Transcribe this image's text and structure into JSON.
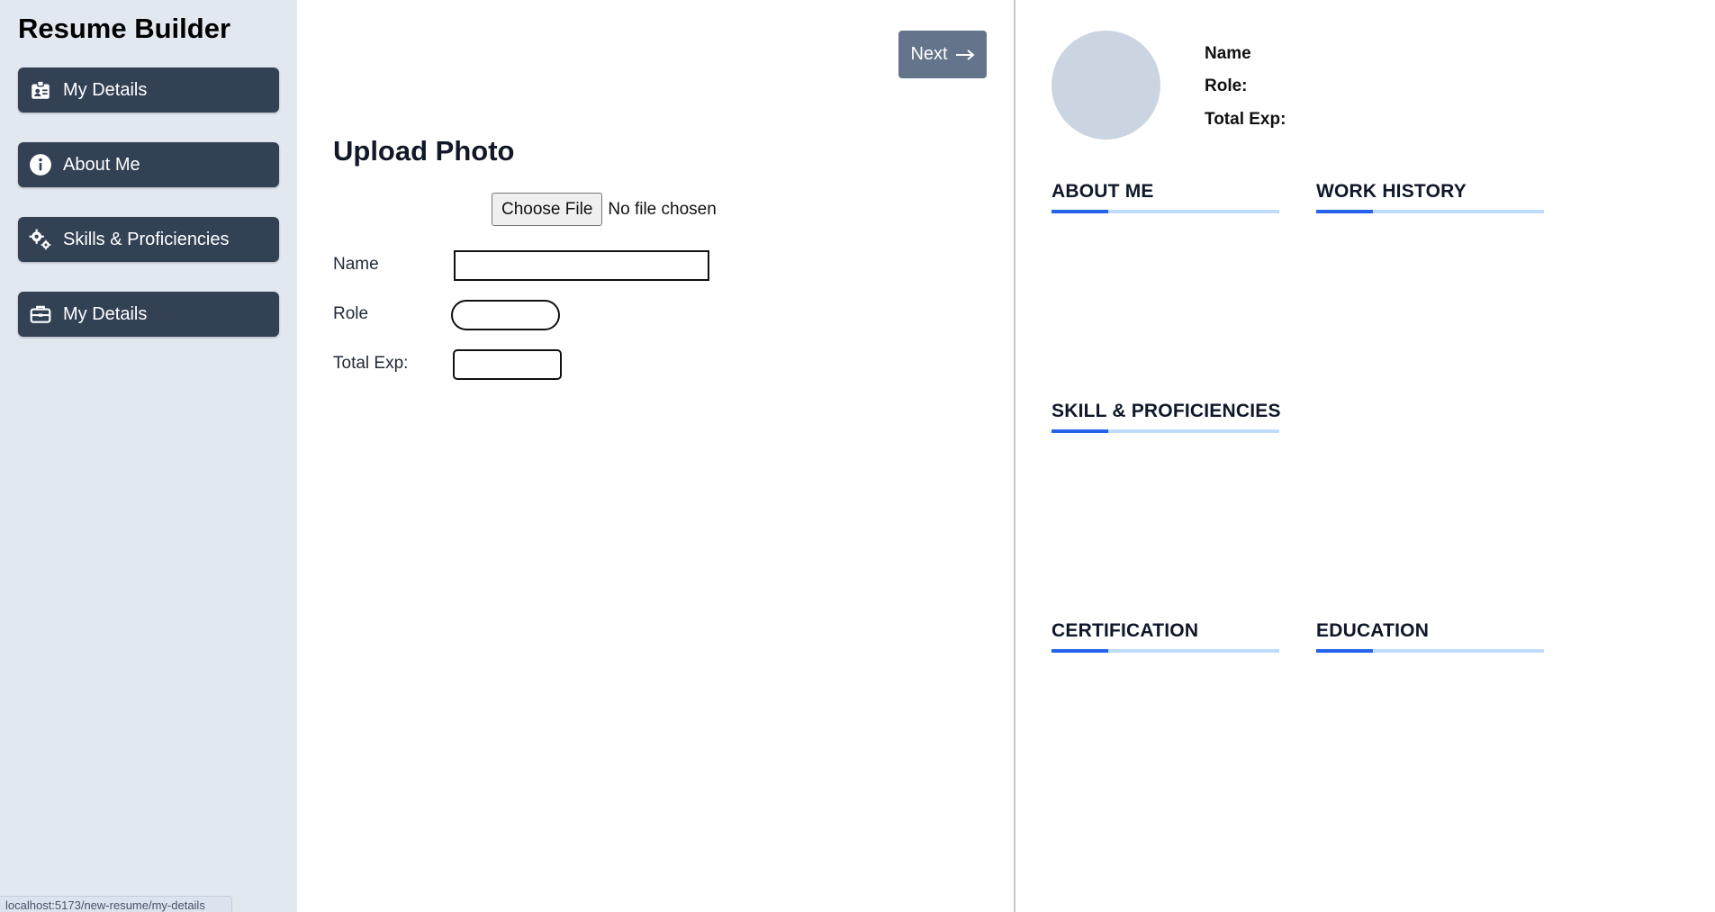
{
  "sidebar": {
    "title": "Resume Builder",
    "items": [
      {
        "label": "My Details",
        "icon": "id-badge-icon"
      },
      {
        "label": "About Me",
        "icon": "info-circle-icon"
      },
      {
        "label": "Skills & Proficiencies",
        "icon": "gears-icon"
      },
      {
        "label": "My Details",
        "icon": "briefcase-icon"
      }
    ]
  },
  "status_bar": {
    "url": "localhost:5173/new-resume/my-details"
  },
  "editor": {
    "next_label": "Next",
    "next_icon": "arrow-right-icon",
    "section_title": "Upload Photo",
    "file_button": "Choose File",
    "file_status": "No file chosen",
    "fields": {
      "name_label": "Name",
      "name_value": "",
      "role_label": "Role",
      "role_value": "",
      "exp_label": "Total Exp:",
      "exp_value": ""
    }
  },
  "preview": {
    "name_label": "Name",
    "role_label": "Role:",
    "exp_label": "Total Exp:",
    "sections": {
      "about": "ABOUT ME",
      "work": "WORK HISTORY",
      "skills": "SKILL & PROFICIENCIES",
      "certification": "CERTIFICATION",
      "education": "EDUCATION"
    }
  },
  "colors": {
    "sidebar_bg": "#e2e8f0",
    "nav_button": "#334155",
    "next_button": "#64748b",
    "avatar": "#cbd5e1",
    "accent": "#2563eb",
    "accent_light": "#bfdbfe"
  }
}
